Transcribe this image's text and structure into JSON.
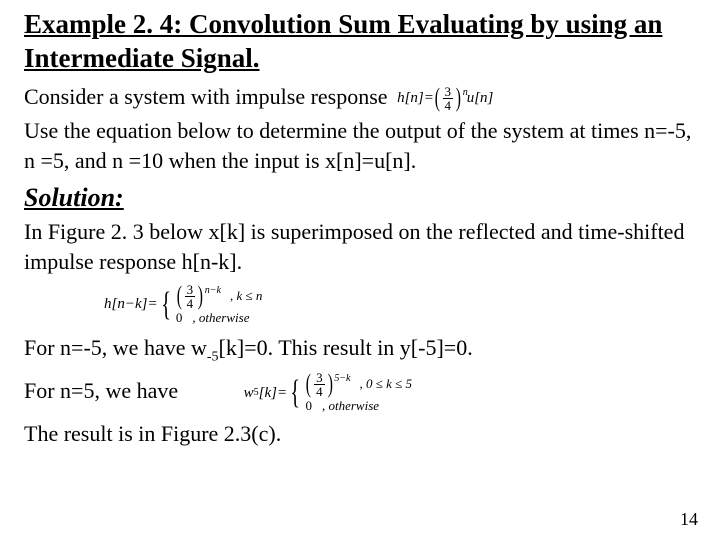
{
  "title": "Example 2. 4: Convolution Sum Evaluating by using an Intermediate Signal.",
  "p1a": "Consider a system with impulse response",
  "eq1": {
    "lhs": "h[n]=",
    "frac_n": "3",
    "frac_d": "4",
    "exp": "n",
    "tail": "u[n]"
  },
  "p2": "Use the equation below to determine the output of the system at times n=-5, n =5, and n =10 when the input is x[n]=u[n].",
  "solution": "Solution:",
  "p3": "In Figure 2. 3 below x[k] is superimposed on the reflected and time-shifted impulse response h[n-k].",
  "eq2": {
    "lhs": "h[n−k]=",
    "row1_frac_n": "3",
    "row1_frac_d": "4",
    "row1_exp": "n−k",
    "row1_cond": ", k ≤ n",
    "row2_val": "0",
    "row2_cond": ", otherwise"
  },
  "p4a": "For n=-5, we have w",
  "p4b": "-5",
  "p4c": "[k]=0. This result in y[-5]=0.",
  "p5a": "For n=5, we have",
  "eq3": {
    "lhs_a": "w",
    "lhs_sub": "5",
    "lhs_b": "[k]=",
    "row1_frac_n": "3",
    "row1_frac_d": "4",
    "row1_exp": "5−k",
    "row1_cond": ", 0 ≤ k ≤ 5",
    "row2_val": "0",
    "row2_cond": ", otherwise"
  },
  "p6": "The result is in Figure 2.3(c).",
  "pagenum": "14"
}
